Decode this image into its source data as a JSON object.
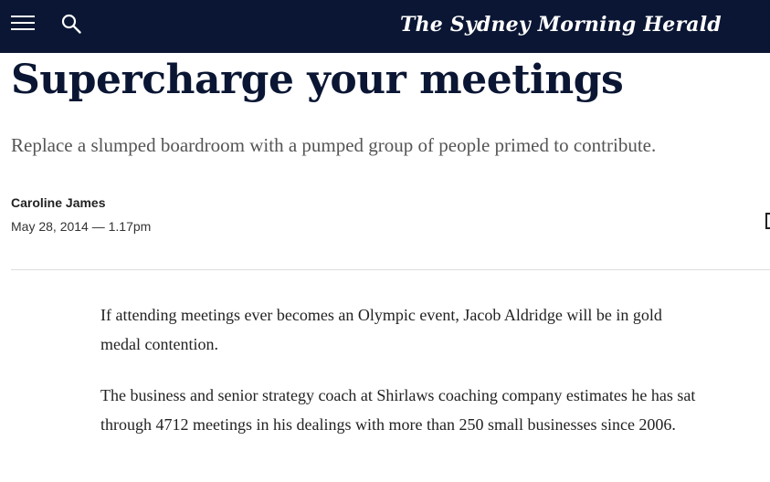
{
  "header": {
    "menu_icon": "hamburger-menu-icon",
    "search_icon": "search-icon",
    "masthead": "The Sydney Morning Herald",
    "background_color": "#0a1633"
  },
  "article": {
    "headline": "Supercharge your meetings",
    "standfirst": "Replace a slumped boardroom with a pumped group of people primed to contribute.",
    "author": "Caroline James",
    "date": "May 28, 2014 — 1.17pm",
    "paragraphs": [
      "If attending meetings ever becomes an Olympic event, Jacob Aldridge will be in gold medal contention.",
      "The business and senior strategy coach at Shirlaws coaching company estimates he has sat through 4712 meetings in his dealings with more than 250 small businesses since 2006."
    ]
  }
}
